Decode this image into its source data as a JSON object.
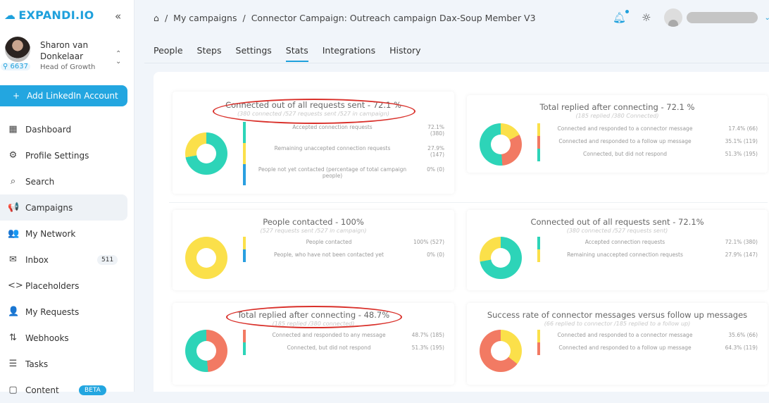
{
  "app": {
    "logo": "EXPANDI.IO",
    "collapse": "«"
  },
  "user": {
    "name": "Sharon van Donkelaar",
    "role": "Head of Growth",
    "count": "6637"
  },
  "add_account": "Add LinkedIn Account",
  "nav": [
    {
      "label": "Dashboard",
      "icon": "▦"
    },
    {
      "label": "Profile Settings",
      "icon": "⚙"
    },
    {
      "label": "Search",
      "icon": "⌕"
    },
    {
      "label": "Campaigns",
      "icon": "📢",
      "active": true
    },
    {
      "label": "My Network",
      "icon": "👥"
    },
    {
      "label": "Inbox",
      "icon": "✉",
      "badge": "511"
    },
    {
      "label": "Placeholders",
      "icon": "<>"
    },
    {
      "label": "My Requests",
      "icon": "👤"
    },
    {
      "label": "Webhooks",
      "icon": "⇅"
    },
    {
      "label": "Tasks",
      "icon": "☰"
    },
    {
      "label": "Content",
      "icon": "▢",
      "beta": "BETA"
    }
  ],
  "breadcrumb": [
    "My campaigns",
    "Connector Campaign: Outreach campaign Dax-Soup Member V3"
  ],
  "tabs": [
    "People",
    "Steps",
    "Settings",
    "Stats",
    "Integrations",
    "History"
  ],
  "active_tab": "Stats",
  "colors": {
    "teal": "#2dd4b8",
    "yellow": "#fbe04a",
    "red": "#f27a63",
    "blue": "#2a9fe0"
  },
  "cards": [
    {
      "title": "Connected out of all requests sent - 72.1 %",
      "subtitle": "(380 connected /527 requests sent /527 in campaign)",
      "highlighted": true,
      "rows": [
        {
          "label": "Accepted connection requests",
          "value": "72.1% (380)",
          "pct": 72.1,
          "color": "teal"
        },
        {
          "label": "Remaining unaccepted connection requests",
          "value": "27.9% (147)",
          "pct": 27.9,
          "color": "yellow"
        },
        {
          "label": "People not yet contacted (percentage of total campaign people)",
          "value": "0% (0)",
          "pct": 0,
          "color": "blue"
        }
      ]
    },
    {
      "title": "Total replied after connecting - 72.1 %",
      "subtitle": "(185 replied /380 Connected)",
      "rows": [
        {
          "label": "Connected and responded to a connector message",
          "value": "17.4% (66)",
          "pct": 17.4,
          "color": "yellow"
        },
        {
          "label": "Connected and responded to a follow up message",
          "value": "35.1% (119)",
          "pct": 31.3,
          "color": "red"
        },
        {
          "label": "Connected, but did not respond",
          "value": "51.3% (195)",
          "pct": 51.3,
          "color": "teal"
        }
      ]
    },
    {
      "title": "People contacted - 100%",
      "subtitle": "(527 requests sent /527 in campaign)",
      "rows": [
        {
          "label": "People contacted",
          "value": "100% (527)",
          "pct": 100,
          "color": "yellow"
        },
        {
          "label": "People, who have not been contacted yet",
          "value": "0% (0)",
          "pct": 0,
          "color": "blue"
        }
      ]
    },
    {
      "title": "Connected out of all requests sent - 72.1%",
      "subtitle": "(380 connected /527 requests sent)",
      "rows": [
        {
          "label": "Accepted connection requests",
          "value": "72.1% (380)",
          "pct": 72.1,
          "color": "teal"
        },
        {
          "label": "Remaining unaccepted connection requests",
          "value": "27.9% (147)",
          "pct": 27.9,
          "color": "yellow"
        }
      ]
    },
    {
      "title": "Total replied after connecting - 48.7%",
      "subtitle": "(185 replied /380 connected)",
      "highlighted": true,
      "rows": [
        {
          "label": "Connected and responded to any message",
          "value": "48.7% (185)",
          "pct": 48.7,
          "color": "red"
        },
        {
          "label": "Connected, but did not respond",
          "value": "51.3% (195)",
          "pct": 51.3,
          "color": "teal"
        }
      ]
    },
    {
      "title": "Success rate of connector messages versus follow up messages",
      "subtitle": "(66 replied to connector /185 replied to a follow up)",
      "rows": [
        {
          "label": "Connected and responded to a connector message",
          "value": "35.6% (66)",
          "pct": 35.6,
          "color": "yellow"
        },
        {
          "label": "Connected and responded to a follow up message",
          "value": "64.3% (119)",
          "pct": 64.4,
          "color": "red"
        }
      ]
    }
  ]
}
